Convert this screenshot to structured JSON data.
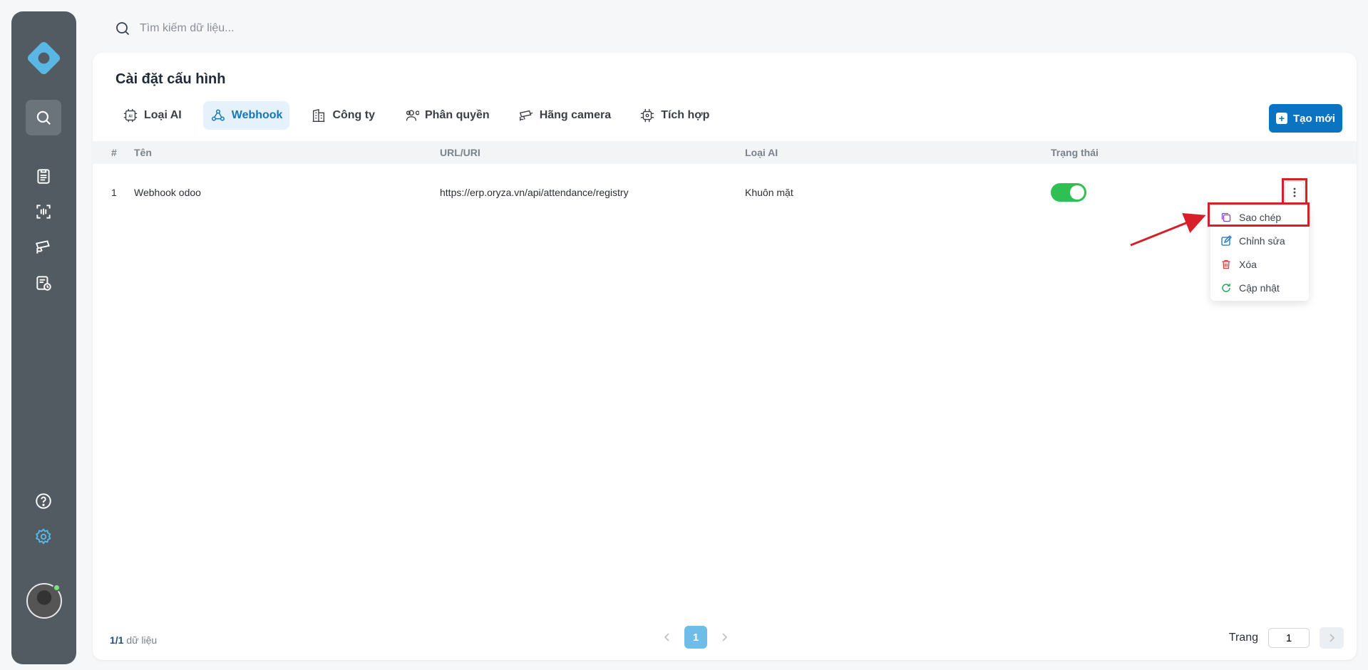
{
  "search": {
    "placeholder": "Tìm kiếm dữ liệu..."
  },
  "page": {
    "title": "Cài đặt cấu hình"
  },
  "tabs": [
    {
      "label": "Loại AI",
      "icon": "ai-chip-icon"
    },
    {
      "label": "Webhook",
      "icon": "webhook-icon",
      "active": true
    },
    {
      "label": "Công ty",
      "icon": "building-icon"
    },
    {
      "label": "Phân quyền",
      "icon": "users-icon"
    },
    {
      "label": "Hãng camera",
      "icon": "camera-icon"
    },
    {
      "label": "Tích hợp",
      "icon": "integration-icon"
    }
  ],
  "new_button": {
    "label": "Tạo mới"
  },
  "table": {
    "headers": {
      "index": "#",
      "name": "Tên",
      "url": "URL/URI",
      "ai_type": "Loại AI",
      "status": "Trạng thái"
    },
    "rows": [
      {
        "index": "1",
        "name": "Webhook odoo",
        "url": "https://erp.oryza.vn/api/attendance/registry",
        "ai_type": "Khuôn mặt",
        "status_on": true
      }
    ]
  },
  "row_menu": {
    "items": [
      {
        "label": "Sao chép",
        "icon": "copy-icon",
        "color": "#8b3fd9"
      },
      {
        "label": "Chỉnh sửa",
        "icon": "edit-icon",
        "color": "#1677b8"
      },
      {
        "label": "Xóa",
        "icon": "trash-icon",
        "color": "#e03a3a"
      },
      {
        "label": "Cập nhật",
        "icon": "refresh-icon",
        "color": "#16a34a"
      }
    ]
  },
  "footer": {
    "count_current": "1",
    "count_total": "/1",
    "count_suffix": " dữ liệu",
    "current_page": "1",
    "page_label": "Trang",
    "page_input": "1"
  },
  "colors": {
    "accent": "#0a74c2",
    "toggle_on": "#2fbf52",
    "highlight": "#d71f2a",
    "sidebar": "#525a62"
  }
}
